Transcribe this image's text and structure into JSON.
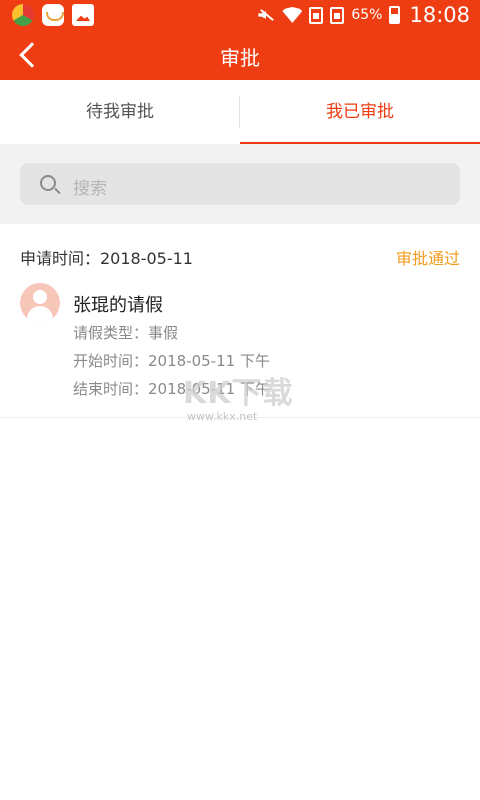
{
  "status_bar": {
    "battery": "65%",
    "time": "18:08",
    "icons": [
      "chrome-icon",
      "store-icon",
      "gallery-icon",
      "mute-icon",
      "wifi-icon",
      "sim-icon",
      "sim-icon",
      "battery-icon"
    ]
  },
  "header": {
    "title": "审批",
    "back_icon": "back-arrow-icon",
    "color": "#ee3d12"
  },
  "tabs": [
    {
      "label": "待我审批",
      "active": false
    },
    {
      "label": "我已审批",
      "active": true
    }
  ],
  "search": {
    "placeholder": "搜索",
    "icon": "search-icon"
  },
  "records": [
    {
      "apply_time": "申请时间：2018-05-11",
      "status": "审批通过",
      "status_color": "#f29b1e",
      "title": "张琨的请假",
      "details": [
        "请假类型：事假",
        "开始时间：2018-05-11  下午",
        "结束时间：2018-05-11  下午"
      ]
    }
  ],
  "watermark": {
    "logo": "KK下载",
    "url": "www.kkx.net"
  }
}
